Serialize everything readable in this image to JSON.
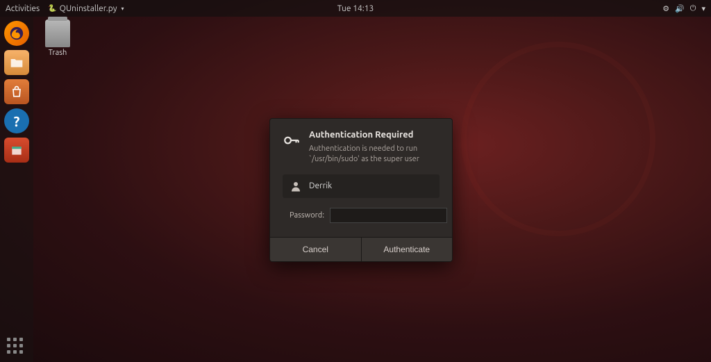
{
  "topbar": {
    "activities": "Activities",
    "app_name": "QUninstaller.py",
    "clock": "Tue 14:13"
  },
  "desktop": {
    "trash_label": "Trash"
  },
  "dialog": {
    "title": "Authentication Required",
    "message": "Authentication is needed to run `/usr/bin/sudo' as the super user",
    "user_name": "Derrik",
    "password_label": "Password:",
    "password_value": "",
    "cancel_label": "Cancel",
    "authenticate_label": "Authenticate"
  }
}
